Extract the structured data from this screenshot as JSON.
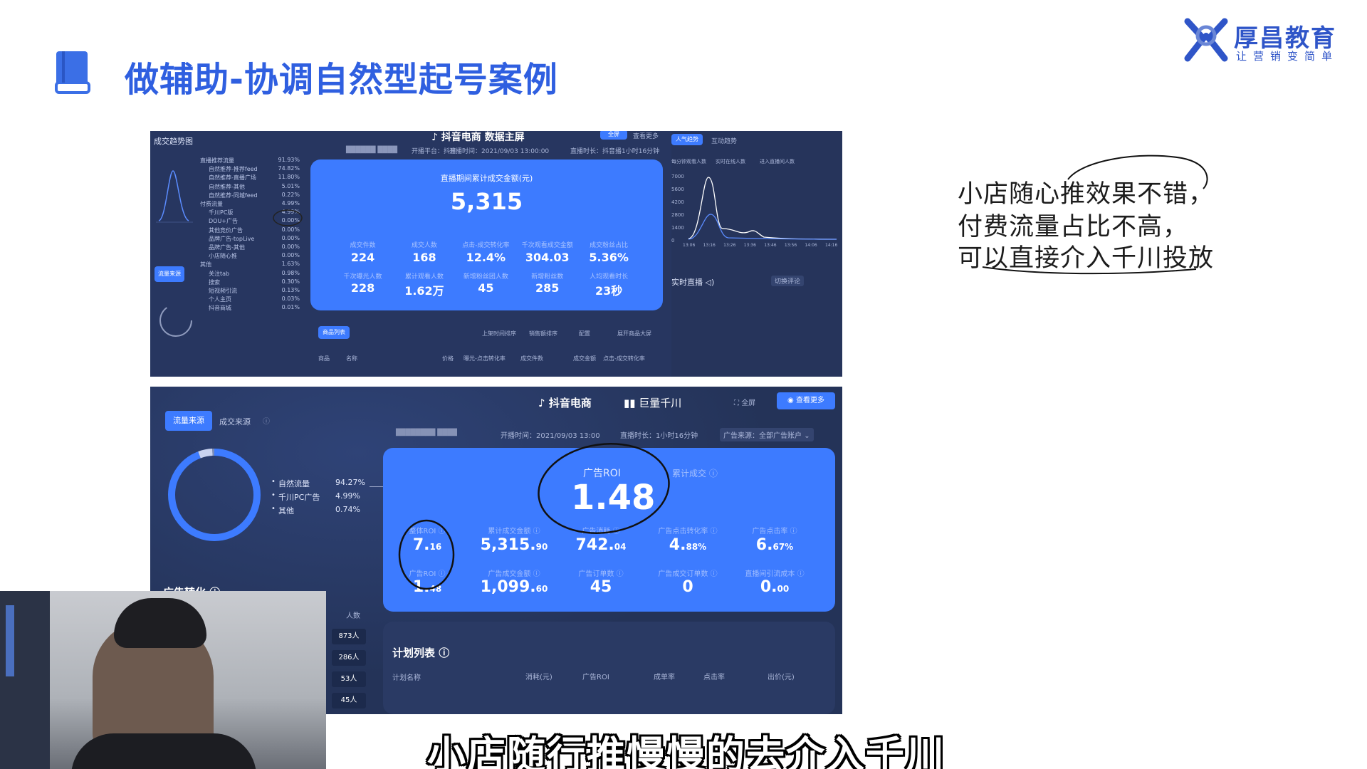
{
  "slide": {
    "title": "做辅助-协调自然型起号案例",
    "logo": {
      "name": "厚昌教育",
      "slogan": "让营销变简单"
    },
    "note_lines": [
      "小店随心推效果不错，",
      "付费流量占比不高，",
      "可以直接介入千川投放"
    ],
    "subtitle": "小店随行推慢慢的去介入千川"
  },
  "upper": {
    "header": {
      "brand": "抖音电商",
      "title": "数据主屏",
      "fullscreen": "全屏",
      "more": "查看更多",
      "start_time": "开播时间：2021/09/03 13:00:00",
      "duration": "直播时长：抖音播1小时16分钟",
      "platform": "开播平台：抖音"
    },
    "left_title": "成交趋势图",
    "left_rows": [
      {
        "label": "直播推荐流量",
        "pct": "91.93%"
      },
      {
        "label": "自然推荐-推荐feed",
        "pct": "74.82%"
      },
      {
        "label": "自然推荐-直播广场",
        "pct": "11.80%"
      },
      {
        "label": "自然推荐-其他",
        "pct": "5.01%"
      },
      {
        "label": "自然推荐-同城feed",
        "pct": "0.22%"
      },
      {
        "label": "付费流量",
        "pct": "4.99%"
      },
      {
        "label": "千川PC版",
        "pct": "4.99%"
      },
      {
        "label": "DOU+广告",
        "pct": "0.00%"
      },
      {
        "label": "其他竞价广告",
        "pct": "0.00%"
      },
      {
        "label": "品牌广告-topLive",
        "pct": "0.00%"
      },
      {
        "label": "品牌广告-其他",
        "pct": "0.00%"
      },
      {
        "label": "小店随心推",
        "pct": "0.00%"
      },
      {
        "label": "其他",
        "pct": "1.63%"
      },
      {
        "label": "关注tab",
        "pct": "0.98%"
      },
      {
        "label": "搜索",
        "pct": "0.30%"
      },
      {
        "label": "短视频引流",
        "pct": "0.13%"
      },
      {
        "label": "个人主页",
        "pct": "0.03%"
      },
      {
        "label": "抖音商城",
        "pct": "0.01%"
      }
    ],
    "left_button": "流量来源",
    "card_title": "直播期间累计成交金额(元)",
    "card_total": "5,315",
    "metrics_row1": [
      {
        "label": "成交件数",
        "value": "224"
      },
      {
        "label": "成交人数",
        "value": "168"
      },
      {
        "label": "点击-成交转化率",
        "value": "12.4%"
      },
      {
        "label": "千次观看成交金额",
        "value": "304.03"
      },
      {
        "label": "成交粉丝占比",
        "value": "5.36%"
      }
    ],
    "metrics_row2": [
      {
        "label": "千次曝光人数",
        "value": "228"
      },
      {
        "label": "累计观看人数",
        "value": "1.62万"
      },
      {
        "label": "新增粉丝团人数",
        "value": "45"
      },
      {
        "label": "新增粉丝数",
        "value": "285"
      },
      {
        "label": "人均观看时长",
        "value": "23秒"
      }
    ],
    "list_button": "商品列表",
    "sort_options": [
      "上架时间排序",
      "销售额排序",
      "配置",
      "展开商品大屏"
    ],
    "table_headers": [
      "商品",
      "名称",
      "价格",
      "曝光-点击转化率",
      "成交件数",
      "成交金额",
      "点击-成交转化率"
    ],
    "right_tabs": [
      "人气趋势",
      "互动趋势"
    ],
    "right_legend": [
      "每分钟观看人数",
      "实时在线人数",
      "进入直播间人数"
    ],
    "right_yticks": [
      "7000",
      "5600",
      "4200",
      "2800",
      "1400",
      "0"
    ],
    "right_xticks": [
      "13:06",
      "13:16",
      "13:26",
      "13:36",
      "13:46",
      "13:56",
      "14:06",
      "14:16"
    ],
    "live_label": "实时直播",
    "switch_label": "切换评论"
  },
  "lower": {
    "header": {
      "brand": "抖音电商",
      "partner": "巨量千川",
      "fullscreen": "全屏",
      "more": "查看更多",
      "start_time": "开播时间：2021/09/03 13:00",
      "duration": "直播时长：1小时16分钟",
      "ad_source": "广告来源：全部广告账户"
    },
    "tabs": [
      "流量来源",
      "成交来源"
    ],
    "donut_legend": [
      {
        "label": "自然流量",
        "pct": "94.27%"
      },
      {
        "label": "千川PC广告",
        "pct": "4.99%"
      },
      {
        "label": "其他",
        "pct": "0.74%"
      }
    ],
    "ad_conv_title": "广告转化",
    "people_col": "人数",
    "people": [
      "873人",
      "286人",
      "53人",
      "45人"
    ],
    "roi_label": "广告ROI",
    "roi_value": "1.48",
    "cumulative_label": "累计成交",
    "metrics_row1": [
      {
        "label": "整体ROI",
        "main": "7.",
        "dec": "16"
      },
      {
        "label": "累计成交金额",
        "main": "5,315.",
        "dec": "90"
      },
      {
        "label": "广告消耗",
        "main": "742.",
        "dec": "04"
      },
      {
        "label": "广告点击转化率",
        "main": "4.",
        "dec": "88%"
      },
      {
        "label": "广告点击率",
        "main": "6.",
        "dec": "67%"
      }
    ],
    "metrics_row2": [
      {
        "label": "广告ROI",
        "main": "1.",
        "dec": "48"
      },
      {
        "label": "广告成交金额",
        "main": "1,099.",
        "dec": "60"
      },
      {
        "label": "广告订单数",
        "main": "45",
        "dec": ""
      },
      {
        "label": "广告成交订单数",
        "main": "0",
        "dec": ""
      },
      {
        "label": "直播间引流成本",
        "main": "0.",
        "dec": "00"
      }
    ],
    "plan_title": "计划列表",
    "plan_headers": [
      "计划名称",
      "消耗(元)",
      "广告ROI",
      "成单率",
      "点击率",
      "出价(元)"
    ],
    "donut": {
      "natural": 0.9427,
      "qianchuan": 0.0499,
      "other": 0.0074
    }
  }
}
